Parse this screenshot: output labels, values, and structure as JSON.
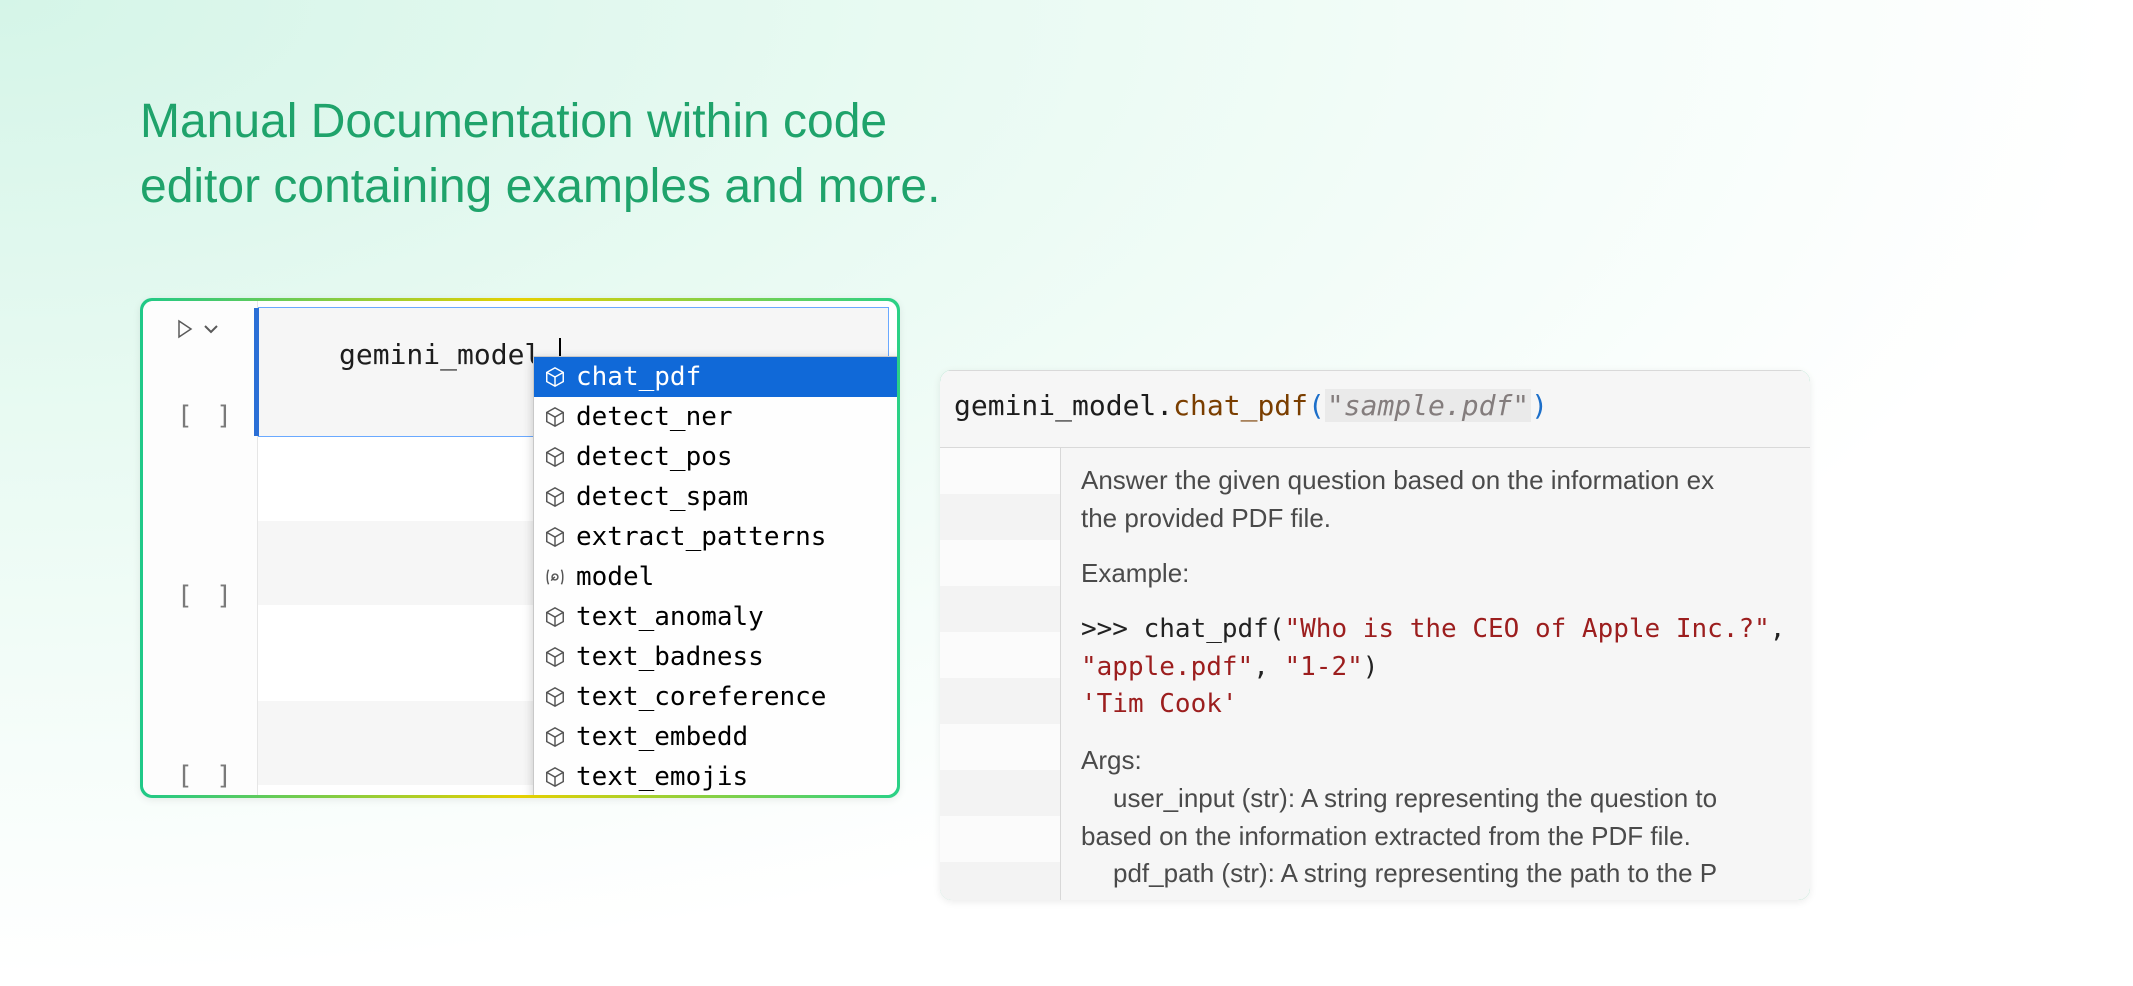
{
  "heading_line1": "Manual Documentation within code",
  "heading_line2": "editor containing examples and more.",
  "panel1": {
    "code_text": "gemini_model.",
    "cell_marker": "[ ]",
    "autocomplete": [
      {
        "icon": "cube",
        "label": "chat_pdf",
        "selected": true
      },
      {
        "icon": "cube",
        "label": "detect_ner",
        "selected": false
      },
      {
        "icon": "cube",
        "label": "detect_pos",
        "selected": false
      },
      {
        "icon": "cube",
        "label": "detect_spam",
        "selected": false
      },
      {
        "icon": "cube",
        "label": "extract_patterns",
        "selected": false
      },
      {
        "icon": "var",
        "label": "model",
        "selected": false
      },
      {
        "icon": "cube",
        "label": "text_anomaly",
        "selected": false
      },
      {
        "icon": "cube",
        "label": "text_badness",
        "selected": false
      },
      {
        "icon": "cube",
        "label": "text_coreference",
        "selected": false
      },
      {
        "icon": "cube",
        "label": "text_embedd",
        "selected": false
      },
      {
        "icon": "cube",
        "label": "text_emojis",
        "selected": false
      }
    ]
  },
  "panel2": {
    "code_obj": "gemini_model",
    "code_method": "chat_pdf",
    "code_arg": "\"sample.pdf\"",
    "doc": {
      "summary1": "Answer the given question based on the information ex",
      "summary2": "the provided PDF file.",
      "example_label": "Example:",
      "example_prompt": ">>> chat_pdf(",
      "example_q": "\"Who is the CEO of Apple Inc.?\"",
      "example_line2a": "\"apple.pdf\"",
      "example_line2b": "\"1-2\"",
      "example_result": "'Tim Cook'",
      "args_label": "Args:",
      "arg1_line1": "user_input (str): A string representing the question to",
      "arg1_line2": "based on the information extracted from the PDF file.",
      "arg2_line1": "pdf_path (str): A string representing the path to the P"
    }
  }
}
